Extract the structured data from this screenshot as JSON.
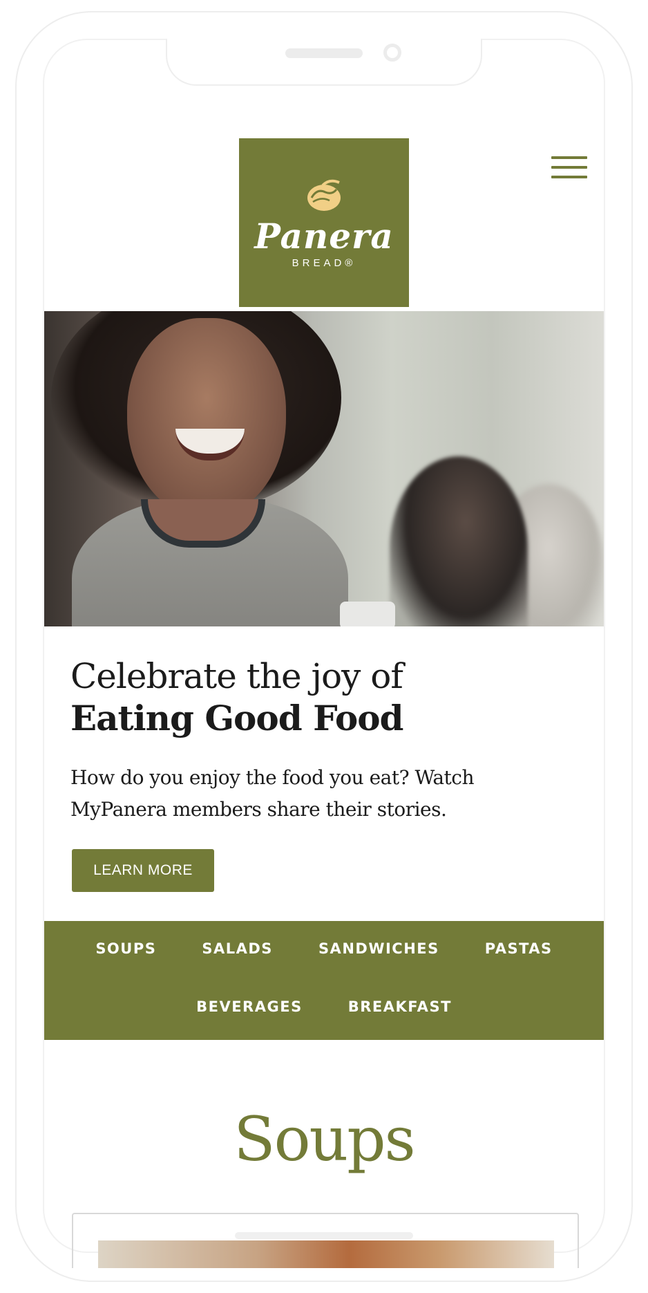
{
  "brand": {
    "logo_word": "Panera",
    "logo_sub": "BREAD®",
    "color": "#737b38",
    "logo_icon": "panera-loaf-icon"
  },
  "header": {
    "menu_icon": "hamburger-menu-icon"
  },
  "hero": {
    "headline_line1": "Celebrate the joy of",
    "headline_line2": "Eating Good Food",
    "body": "How do you enjoy the food you eat? Watch MyPanera members share their stories.",
    "cta_label": "LEARN MORE"
  },
  "categories": {
    "row1": [
      "SOUPS",
      "SALADS",
      "SANDWICHES",
      "PASTAS"
    ],
    "row2": [
      "BEVERAGES",
      "BREAKFAST"
    ]
  },
  "section": {
    "title": "Soups"
  }
}
